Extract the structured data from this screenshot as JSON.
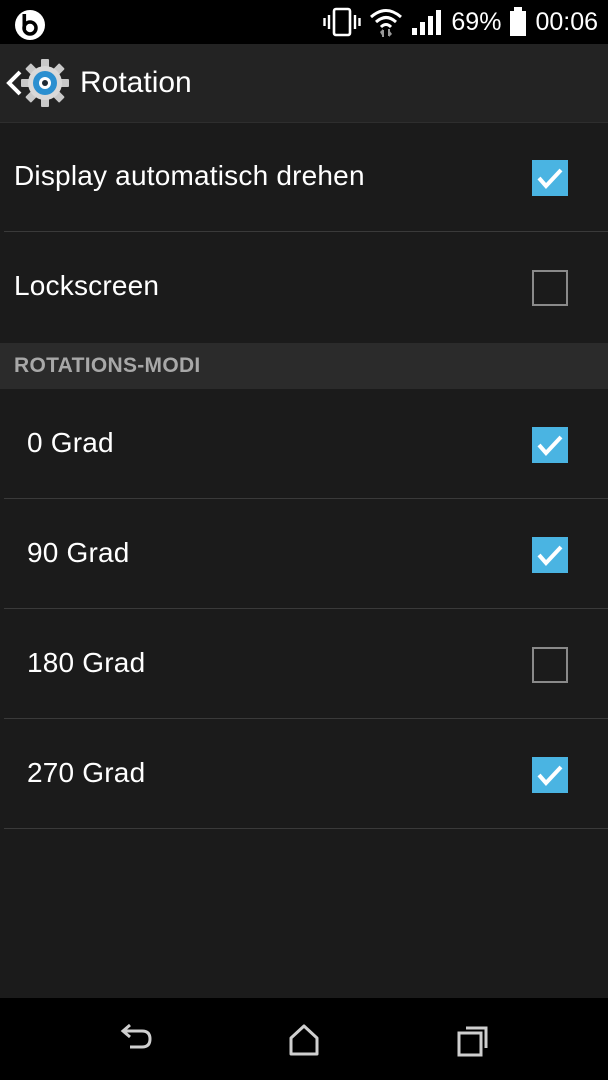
{
  "status_bar": {
    "battery_percent": "69%",
    "time": "00:06",
    "icons": [
      "beats-icon",
      "vibrate-icon",
      "wifi-icon",
      "signal-icon",
      "battery-icon"
    ]
  },
  "action_bar": {
    "title": "Rotation",
    "icons": [
      "back-chevron-icon",
      "gear-icon"
    ]
  },
  "settings": [
    {
      "label": "Display automatisch drehen",
      "checked": true
    },
    {
      "label": "Lockscreen",
      "checked": false
    }
  ],
  "section": {
    "title": "ROTATIONS-MODI"
  },
  "modes": [
    {
      "label": "0 Grad",
      "checked": true
    },
    {
      "label": "90 Grad",
      "checked": true
    },
    {
      "label": "180 Grad",
      "checked": false
    },
    {
      "label": "270 Grad",
      "checked": true
    }
  ],
  "nav_bar": {
    "icons": [
      "back-icon",
      "home-icon",
      "recents-icon"
    ]
  },
  "colors": {
    "accent": "#4ab4e2",
    "background": "#1b1b1b",
    "action_bar": "#232323",
    "section_header": "#2b2b2b"
  }
}
